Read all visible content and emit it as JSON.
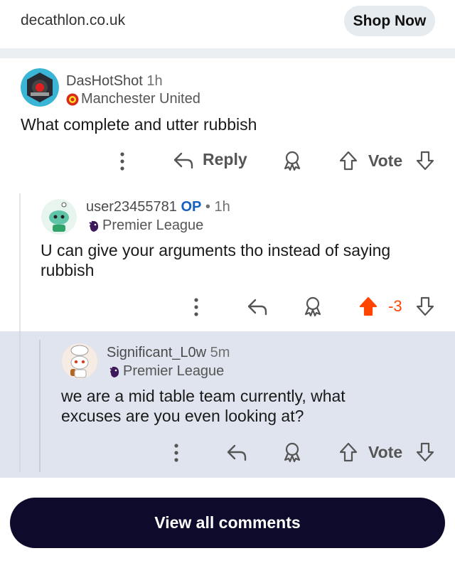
{
  "ad": {
    "domain": "decathlon.co.uk",
    "cta": "Shop Now"
  },
  "comments": [
    {
      "username": "DasHotShot",
      "time": "1h",
      "flair": "Manchester United",
      "body": "What complete and utter rubbish",
      "reply_label": "Reply",
      "vote_label": "Vote"
    },
    {
      "username": "user23455781",
      "op": "OP",
      "dot": "•",
      "time": "1h",
      "flair": "Premier League",
      "body": "U can give your arguments tho instead of saying rubbish",
      "score": "-3",
      "upvoted": true
    },
    {
      "username": "Significant_L0w",
      "time": "5m",
      "flair": "Premier League",
      "body": "we are a mid table team currently, what excuses are you even looking at?",
      "vote_label": "Vote"
    }
  ],
  "view_all_label": "View all comments",
  "colors": {
    "upvote_active": "#ff4500",
    "op": "#1660c0",
    "view_all_bg": "#0d0a2b",
    "highlight_bg": "#dfe4ee"
  }
}
